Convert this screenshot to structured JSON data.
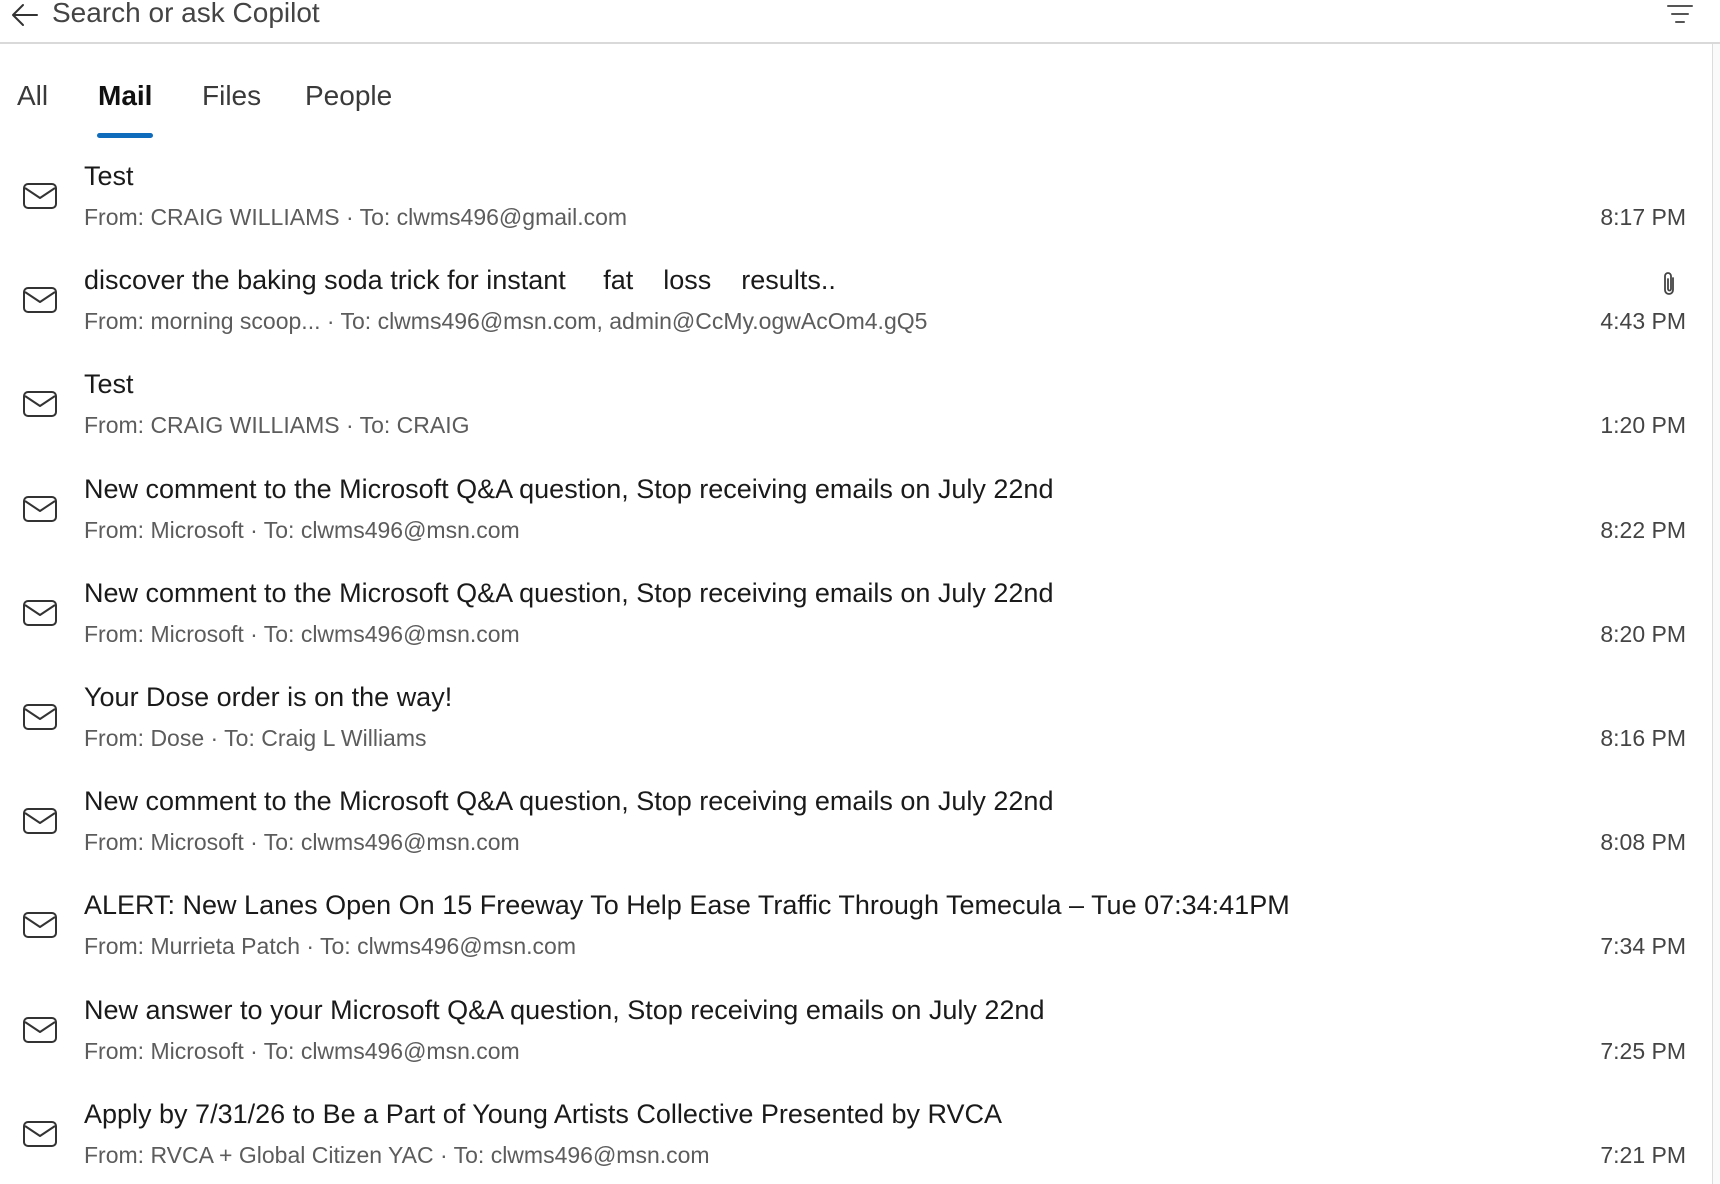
{
  "search": {
    "placeholder": "Search or ask Copilot"
  },
  "icons": {
    "back": "back-arrow-icon",
    "filter": "filter-icon",
    "mail": "envelope-icon",
    "attachment": "paperclip-icon"
  },
  "colors": {
    "accent": "#0f6cbd",
    "meta_text": "#5c5c5c"
  },
  "tabs": [
    {
      "label": "All",
      "active": false
    },
    {
      "label": "Mail",
      "active": true
    },
    {
      "label": "Files",
      "active": false
    },
    {
      "label": "People",
      "active": false
    }
  ],
  "mails": [
    {
      "subject": "Test",
      "meta": "From: CRAIG WILLIAMS · To: clwms496@gmail.com",
      "time": "8:17 PM",
      "attachment": false
    },
    {
      "subject": "discover the baking soda trick for instant     fat    loss    results..",
      "meta": "From: morning scoop... · To: clwms496@msn.com, admin@CcMy.ogwAcOm4.gQ5",
      "time": "4:43 PM",
      "attachment": true
    },
    {
      "subject": "Test",
      "meta": "From: CRAIG WILLIAMS · To: CRAIG",
      "time": "1:20 PM",
      "attachment": false
    },
    {
      "subject": "New comment to the Microsoft Q&A question, Stop receiving emails on July 22nd",
      "meta": "From: Microsoft · To: clwms496@msn.com",
      "time": "8:22 PM",
      "attachment": false
    },
    {
      "subject": "New comment to the Microsoft Q&A question, Stop receiving emails on July 22nd",
      "meta": "From: Microsoft · To: clwms496@msn.com",
      "time": "8:20 PM",
      "attachment": false
    },
    {
      "subject": "Your Dose order is on the way!",
      "meta": "From: Dose · To: Craig L Williams",
      "time": "8:16 PM",
      "attachment": false
    },
    {
      "subject": "New comment to the Microsoft Q&A question, Stop receiving emails on July 22nd",
      "meta": "From: Microsoft · To: clwms496@msn.com",
      "time": "8:08 PM",
      "attachment": false
    },
    {
      "subject": "ALERT: New Lanes Open On 15 Freeway To Help Ease Traffic Through Temecula – Tue 07:34:41PM",
      "meta": "From: Murrieta Patch · To: clwms496@msn.com",
      "time": "7:34 PM",
      "attachment": false
    },
    {
      "subject": "New answer to your Microsoft Q&A question, Stop receiving emails on July 22nd",
      "meta": "From: Microsoft · To: clwms496@msn.com",
      "time": "7:25 PM",
      "attachment": false
    },
    {
      "subject": "Apply by 7/31/26 to Be a Part of Young Artists Collective Presented by RVCA",
      "meta": "From: RVCA + Global Citizen YAC · To: clwms496@msn.com",
      "time": "7:21 PM",
      "attachment": false
    }
  ]
}
